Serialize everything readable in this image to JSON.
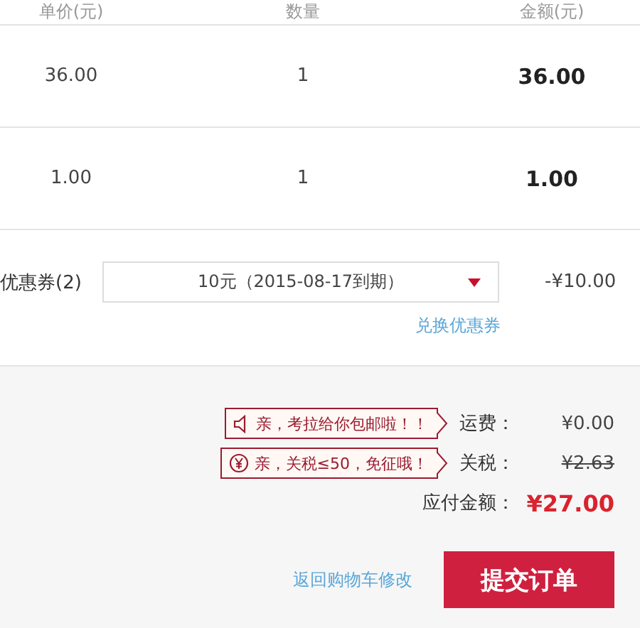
{
  "table": {
    "columns": [
      "单价(元)",
      "数量",
      "金额(元)"
    ],
    "rows": [
      {
        "price": "36.00",
        "quantity": "1",
        "amount": "36.00"
      },
      {
        "price": "1.00",
        "quantity": "1",
        "amount": "1.00"
      }
    ]
  },
  "coupon": {
    "label": "优惠券(2)",
    "selected_option": "10元（2015-08-17到期）",
    "discount": "-¥10.00",
    "exchange_link": "兑换优惠券"
  },
  "fees": [
    {
      "tip": "亲，考拉给你包邮啦！！",
      "label": "运费：",
      "value": "¥0.00",
      "struck": false
    },
    {
      "tip": "亲，关税≤50，免征哦！",
      "label": "关税：",
      "value": "¥2.63",
      "struck": true
    }
  ],
  "total": {
    "label": "应付金额：",
    "value": "¥27.00"
  },
  "back_link": "返回购物车修改",
  "submit_button": "提交订单"
}
